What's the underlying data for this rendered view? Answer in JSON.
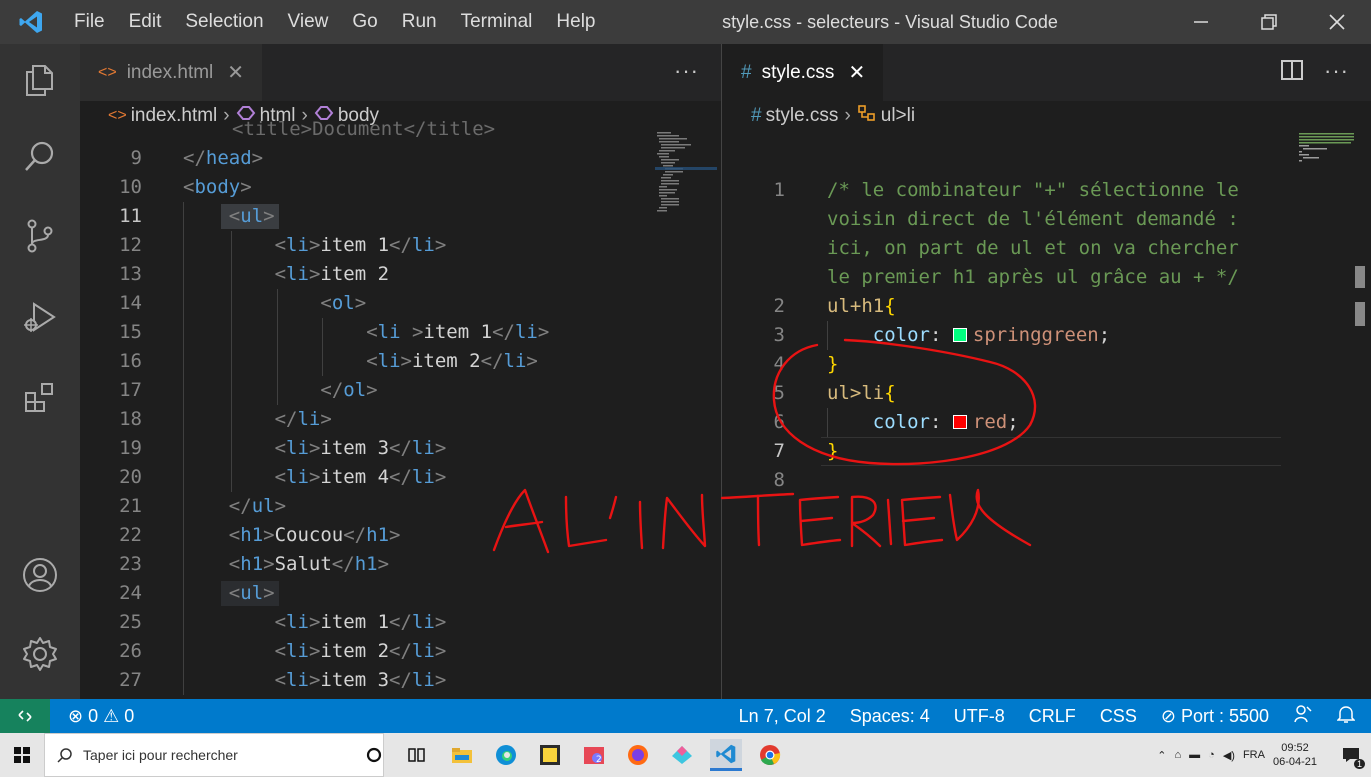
{
  "titlebar": {
    "menu": [
      "File",
      "Edit",
      "Selection",
      "View",
      "Go",
      "Run",
      "Terminal",
      "Help"
    ],
    "title": "style.css - selecteurs - Visual Studio Code"
  },
  "left_editor": {
    "tab": {
      "label": "index.html"
    },
    "breadcrumb": [
      "index.html",
      "html",
      "body"
    ],
    "partial_line": "<title>Document</title>",
    "lines": [
      {
        "n": "9",
        "tokens": [
          [
            "p",
            "</"
          ],
          [
            "t",
            "head"
          ],
          [
            "p",
            ">"
          ]
        ]
      },
      {
        "n": "10",
        "tokens": [
          [
            "p",
            "<"
          ],
          [
            "t",
            "body"
          ],
          [
            "p",
            ">"
          ]
        ]
      },
      {
        "n": "11",
        "tokens": [
          [
            "p",
            "<"
          ],
          [
            "t",
            "ul"
          ],
          [
            "p",
            ">"
          ]
        ]
      },
      {
        "n": "12",
        "tokens": [
          [
            "p",
            "<"
          ],
          [
            "t",
            "li"
          ],
          [
            "p",
            ">"
          ],
          [
            "x",
            "item 1"
          ],
          [
            "p",
            "</"
          ],
          [
            "t",
            "li"
          ],
          [
            "p",
            ">"
          ]
        ]
      },
      {
        "n": "13",
        "tokens": [
          [
            "p",
            "<"
          ],
          [
            "t",
            "li"
          ],
          [
            "p",
            ">"
          ],
          [
            "x",
            "item 2"
          ]
        ]
      },
      {
        "n": "14",
        "tokens": [
          [
            "p",
            "<"
          ],
          [
            "t",
            "ol"
          ],
          [
            "p",
            ">"
          ]
        ]
      },
      {
        "n": "15",
        "tokens": [
          [
            "p",
            "<"
          ],
          [
            "t",
            "li "
          ],
          [
            "p",
            ">"
          ],
          [
            "x",
            "item 1"
          ],
          [
            "p",
            "</"
          ],
          [
            "t",
            "li"
          ],
          [
            "p",
            ">"
          ]
        ]
      },
      {
        "n": "16",
        "tokens": [
          [
            "p",
            "<"
          ],
          [
            "t",
            "li"
          ],
          [
            "p",
            ">"
          ],
          [
            "x",
            "item 2"
          ],
          [
            "p",
            "</"
          ],
          [
            "t",
            "li"
          ],
          [
            "p",
            ">"
          ]
        ]
      },
      {
        "n": "17",
        "tokens": [
          [
            "p",
            "</"
          ],
          [
            "t",
            "ol"
          ],
          [
            "p",
            ">"
          ]
        ]
      },
      {
        "n": "18",
        "tokens": [
          [
            "p",
            "</"
          ],
          [
            "t",
            "li"
          ],
          [
            "p",
            ">"
          ]
        ]
      },
      {
        "n": "19",
        "tokens": [
          [
            "p",
            "<"
          ],
          [
            "t",
            "li"
          ],
          [
            "p",
            ">"
          ],
          [
            "x",
            "item 3"
          ],
          [
            "p",
            "</"
          ],
          [
            "t",
            "li"
          ],
          [
            "p",
            ">"
          ]
        ]
      },
      {
        "n": "20",
        "tokens": [
          [
            "p",
            "<"
          ],
          [
            "t",
            "li"
          ],
          [
            "p",
            ">"
          ],
          [
            "x",
            "item 4"
          ],
          [
            "p",
            "</"
          ],
          [
            "t",
            "li"
          ],
          [
            "p",
            ">"
          ]
        ]
      },
      {
        "n": "21",
        "tokens": [
          [
            "p",
            "</"
          ],
          [
            "t",
            "ul"
          ],
          [
            "p",
            ">"
          ]
        ]
      },
      {
        "n": "22",
        "tokens": [
          [
            "p",
            "<"
          ],
          [
            "t",
            "h1"
          ],
          [
            "p",
            ">"
          ],
          [
            "x",
            "Coucou"
          ],
          [
            "p",
            "</"
          ],
          [
            "t",
            "h1"
          ],
          [
            "p",
            ">"
          ]
        ]
      },
      {
        "n": "23",
        "tokens": [
          [
            "p",
            "<"
          ],
          [
            "t",
            "h1"
          ],
          [
            "p",
            ">"
          ],
          [
            "x",
            "Salut"
          ],
          [
            "p",
            "</"
          ],
          [
            "t",
            "h1"
          ],
          [
            "p",
            ">"
          ]
        ]
      },
      {
        "n": "24",
        "tokens": [
          [
            "p",
            "<"
          ],
          [
            "t",
            "ul"
          ],
          [
            "p",
            ">"
          ]
        ]
      },
      {
        "n": "25",
        "tokens": [
          [
            "p",
            "<"
          ],
          [
            "t",
            "li"
          ],
          [
            "p",
            ">"
          ],
          [
            "x",
            "item 1"
          ],
          [
            "p",
            "</"
          ],
          [
            "t",
            "li"
          ],
          [
            "p",
            ">"
          ]
        ]
      },
      {
        "n": "26",
        "tokens": [
          [
            "p",
            "<"
          ],
          [
            "t",
            "li"
          ],
          [
            "p",
            ">"
          ],
          [
            "x",
            "item 2"
          ],
          [
            "p",
            "</"
          ],
          [
            "t",
            "li"
          ],
          [
            "p",
            ">"
          ]
        ]
      },
      {
        "n": "27",
        "tokens": [
          [
            "p",
            "<"
          ],
          [
            "t",
            "li"
          ],
          [
            "p",
            ">"
          ],
          [
            "x",
            "item 3"
          ],
          [
            "p",
            "</"
          ],
          [
            "t",
            "li"
          ],
          [
            "p",
            ">"
          ]
        ]
      }
    ]
  },
  "right_editor": {
    "tab": {
      "label": "style.css"
    },
    "breadcrumb": [
      "style.css",
      "ul>li"
    ],
    "lines": [
      {
        "n": "1",
        "tokens": [
          [
            "c",
            "/* le combinateur \"+\" sélectionne le"
          ]
        ]
      },
      {
        "n": "",
        "tokens": [
          [
            "c",
            "voisin direct de l'élément demandé :"
          ]
        ]
      },
      {
        "n": "",
        "tokens": [
          [
            "c",
            "ici, on part de ul et on va chercher"
          ]
        ]
      },
      {
        "n": "",
        "tokens": [
          [
            "c",
            "le premier h1 après ul grâce au + */"
          ]
        ]
      },
      {
        "n": "2",
        "tokens": [
          [
            "s",
            "ul+h1"
          ],
          [
            "b",
            "{"
          ]
        ]
      },
      {
        "n": "3",
        "tokens": [
          [
            "k",
            "color"
          ],
          [
            "x",
            ": "
          ],
          [
            "sw",
            "#00ff7f"
          ],
          [
            "v",
            "springgreen"
          ],
          [
            "x",
            ";"
          ]
        ]
      },
      {
        "n": "4",
        "tokens": [
          [
            "b",
            "}"
          ]
        ]
      },
      {
        "n": "5",
        "tokens": [
          [
            "s",
            "ul>li"
          ],
          [
            "b",
            "{"
          ]
        ]
      },
      {
        "n": "6",
        "tokens": [
          [
            "k",
            "color"
          ],
          [
            "x",
            ": "
          ],
          [
            "sw",
            "#ff0000"
          ],
          [
            "v",
            "red"
          ],
          [
            "x",
            ";"
          ]
        ]
      },
      {
        "n": "7",
        "tokens": [
          [
            "b",
            "}"
          ]
        ]
      },
      {
        "n": "8",
        "tokens": []
      }
    ]
  },
  "annotation": {
    "handwritten": "A L'INTERIEUR"
  },
  "statusbar": {
    "problems": "0",
    "warnings": "0",
    "position": "Ln 7, Col 2",
    "spaces": "Spaces: 4",
    "encoding": "UTF-8",
    "eol": "CRLF",
    "language": "CSS",
    "port": "Port : 5500"
  },
  "taskbar": {
    "search_placeholder": "Taper ici pour rechercher",
    "lang": "FRA",
    "time": "09:52",
    "date": "06-04-21",
    "notif_count": "1"
  },
  "colors": {
    "accent": "#007acc",
    "remote": "#16825d",
    "ink": "#e81313"
  }
}
